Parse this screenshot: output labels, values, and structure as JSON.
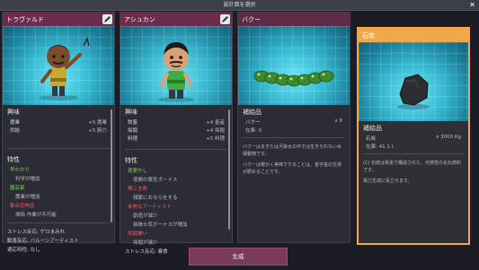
{
  "window": {
    "title": "設計図を選択",
    "close_label": "✕"
  },
  "cards": [
    {
      "name": "トラヴァルド",
      "interests_title": "興味",
      "interests": [
        {
          "label": "農業",
          "value": "+5 農業"
        },
        {
          "label": "供給",
          "value": "+5 腕力"
        }
      ],
      "traits_title": "特性",
      "traits": [
        {
          "label": "早わかり",
          "kind": "pos"
        },
        {
          "label": "科学が増加",
          "kind": "desc"
        },
        {
          "label": "園芸家",
          "kind": "pos"
        },
        {
          "label": "農業が増加",
          "kind": "desc"
        },
        {
          "label": "集合恐怖症",
          "kind": "neg"
        },
        {
          "label": "掃除 作業が不可能",
          "kind": "desc"
        }
      ],
      "stress": "ストレス反応: ゲロまみれ",
      "overjoyed": "歓喜反応: バルーンアーティスト",
      "trait_extra": "適応特性: なし"
    },
    {
      "name": "アシュカン",
      "interests_title": "興味",
      "interests": [
        {
          "label": "牧畜",
          "value": "+4 畜産"
        },
        {
          "label": "採掘",
          "value": "+4 採掘"
        },
        {
          "label": "料理",
          "value": "+5 料理"
        }
      ],
      "traits_title": "特性",
      "traits": [
        {
          "label": "夜更かし",
          "kind": "pos"
        },
        {
          "label": "夜間の属性ボーナス",
          "kind": "desc"
        },
        {
          "label": "罠こき魚",
          "kind": "neg"
        },
        {
          "label": "頻繁におならをする",
          "kind": "desc"
        },
        {
          "label": "未熟なアーティスト",
          "kind": "neg"
        },
        {
          "label": "創造が減少",
          "kind": "desc"
        },
        {
          "label": "装飾士気ボーナスが増加",
          "kind": "desc"
        },
        {
          "label": "採掘嫌い",
          "kind": "neg"
        },
        {
          "label": "採掘が減少",
          "kind": "desc"
        }
      ],
      "stress": "ストレス反応: 暴食"
    },
    {
      "name": "バクー",
      "supply_title": "補給品",
      "supply_item": "バクー",
      "supply_qty": "x 8",
      "supply_sub": "在庫: 0",
      "note1": "バクーはまきたは汚染水の中では生きられない水棲動物です。",
      "note2": "バクーは暖かく美味ですることは、金宇宙の生体が肥めることです。"
    },
    {
      "name": "石炭",
      "supply_title": "補給品",
      "supply_item": "石炭",
      "supply_qty": "x 3000 Kg",
      "supply_sub": "在庫: 41.1 t",
      "note1": "(C) 石炭は炭素で構成された、可燃性の化石燃料です。",
      "note2": "電力生成に役立ちます。"
    }
  ],
  "generate_label": "生成"
}
